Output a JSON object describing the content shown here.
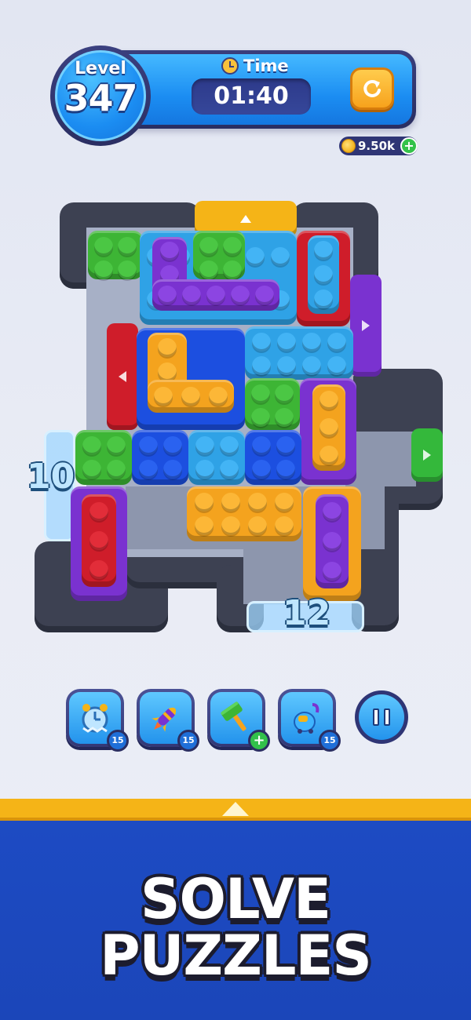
{
  "header": {
    "level_label": "Level",
    "level_number": "347",
    "time_label": "Time",
    "time_value": "01:40",
    "coins": "9.50k",
    "coins_plus": "+"
  },
  "board": {
    "left_gate_count": "10",
    "bottom_gate_count": "12"
  },
  "boosters": [
    {
      "name": "freeze-clock",
      "icon": "frozen-clock-icon",
      "count": "15"
    },
    {
      "name": "rocket",
      "icon": "rocket-icon",
      "count": "15"
    },
    {
      "name": "hammer",
      "icon": "hammer-icon",
      "count": "+"
    },
    {
      "name": "vacuum",
      "icon": "vacuum-icon",
      "count": "15"
    }
  ],
  "promo": {
    "line1": "SOLVE",
    "line2": "PUZZLES"
  },
  "colors": {
    "accent_blue": "#1b8df2",
    "gold": "#f5b417",
    "banner_blue": "#1d4bc3"
  }
}
